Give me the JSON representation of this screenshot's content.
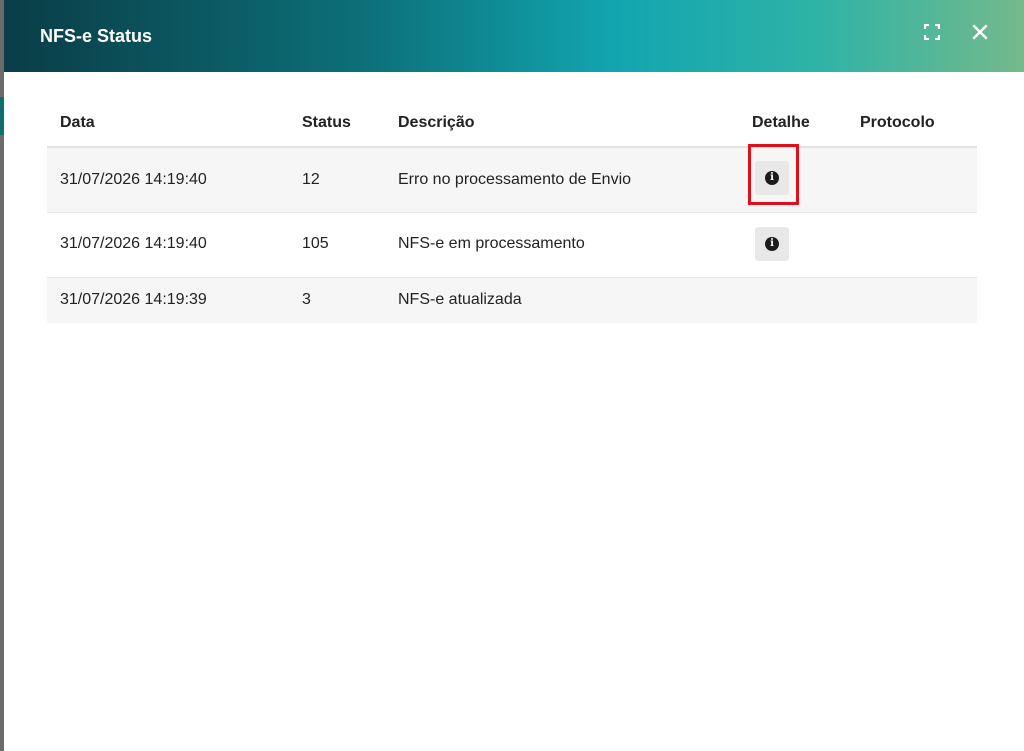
{
  "modal": {
    "title": "NFS-e Status"
  },
  "table": {
    "columns": [
      "Data",
      "Status",
      "Descrição",
      "Detalhe",
      "Protocolo"
    ],
    "rows": [
      {
        "data": "31/07/2026 14:19:40",
        "status": "12",
        "descricao": "Erro no processamento de Envio",
        "has_detail": true,
        "protocolo": ""
      },
      {
        "data": "31/07/2026 14:19:40",
        "status": "105",
        "descricao": "NFS-e em processamento",
        "has_detail": true,
        "protocolo": ""
      },
      {
        "data": "31/07/2026 14:19:39",
        "status": "3",
        "descricao": "NFS-e atualizada",
        "has_detail": false,
        "protocolo": ""
      }
    ]
  },
  "icons": {
    "fullscreen": "fullscreen-icon",
    "close": "close-icon",
    "detail": "info-icon"
  },
  "colors": {
    "header_gradient_start": "#0a3d47",
    "header_gradient_end": "#74b98c",
    "highlight": "#e0101a"
  }
}
